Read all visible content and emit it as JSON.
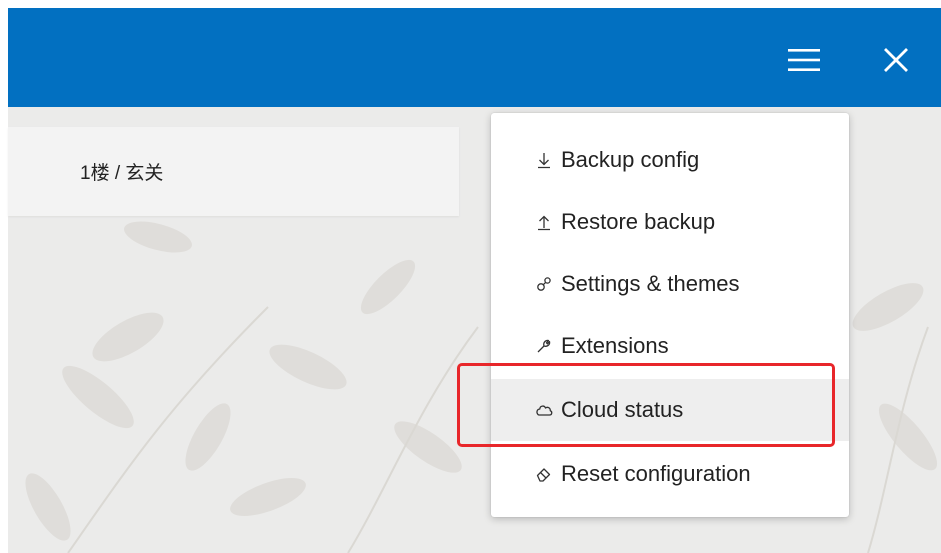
{
  "header": {
    "menu_icon": "hamburger-menu-icon",
    "close_icon": "close-icon",
    "bar_color": "#0270c1"
  },
  "breadcrumb": {
    "text": "1楼 / 玄关"
  },
  "menu": {
    "items": [
      {
        "label": "Backup config",
        "icon": "download-icon"
      },
      {
        "label": "Restore backup",
        "icon": "upload-icon"
      },
      {
        "label": "Settings & themes",
        "icon": "settings-icon"
      },
      {
        "label": "Extensions",
        "icon": "wrench-icon"
      },
      {
        "label": "Cloud status",
        "icon": "cloud-icon",
        "hovered": true
      },
      {
        "label": "Reset configuration",
        "icon": "eraser-icon"
      }
    ]
  },
  "annotation": {
    "highlight_color": "#e8262a",
    "target": "Cloud status"
  }
}
